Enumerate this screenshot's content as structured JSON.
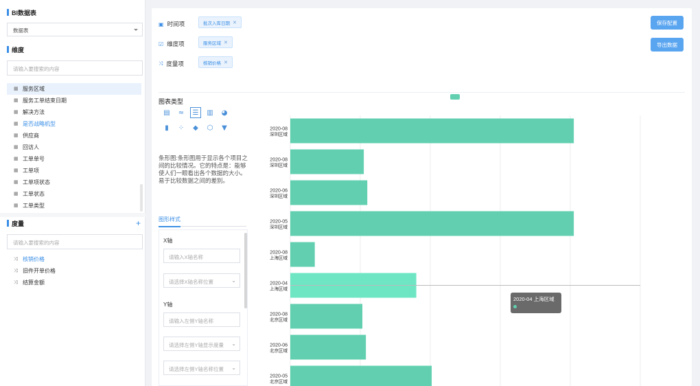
{
  "sidebar": {
    "title": "BI数据表",
    "table_select": "数据表",
    "dimension_title": "维度",
    "dimension_search_placeholder": "请输入要搜索的内容",
    "dimensions": [
      {
        "label": "服务区域",
        "icon": "table-field-icon",
        "highlight": true,
        "blue": false
      },
      {
        "label": "服务工单结束日期",
        "icon": "table-field-icon",
        "highlight": false,
        "blue": false
      },
      {
        "label": "解决方法",
        "icon": "table-field-icon",
        "highlight": false,
        "blue": false
      },
      {
        "label": "是否战略机型",
        "icon": "table-field-icon",
        "highlight": false,
        "blue": true
      },
      {
        "label": "供应商",
        "icon": "table-field-icon",
        "highlight": false,
        "blue": false
      },
      {
        "label": "回访人",
        "icon": "table-field-icon",
        "highlight": false,
        "blue": false
      },
      {
        "label": "工单单号",
        "icon": "table-field-icon",
        "highlight": false,
        "blue": false
      },
      {
        "label": "工单项",
        "icon": "table-field-icon",
        "highlight": false,
        "blue": false
      },
      {
        "label": "工单项状态",
        "icon": "table-field-icon",
        "highlight": false,
        "blue": false
      },
      {
        "label": "工单状态",
        "icon": "table-field-icon",
        "highlight": false,
        "blue": false
      },
      {
        "label": "工单类型",
        "icon": "table-field-icon",
        "highlight": false,
        "blue": false
      }
    ],
    "measure_title": "度量",
    "measure_search_placeholder": "请输入要搜索的内容",
    "measures": [
      {
        "label": "核销价格",
        "icon": "measure-icon",
        "blue": true
      },
      {
        "label": "旧件开单价格",
        "icon": "measure-icon",
        "blue": false
      },
      {
        "label": "结算金额",
        "icon": "measure-icon",
        "blue": false
      }
    ]
  },
  "config": {
    "time_label": "时间项",
    "dimension_label": "维度项",
    "measure_label": "度量项",
    "time_tag": "批次入库日期",
    "dimension_tag": "服务区域",
    "measure_tag": "核销价格",
    "save_button": "保存配置",
    "export_button": "导出数据"
  },
  "chart_panel": {
    "type_title": "图表类型",
    "description": "条形图:条形图用于显示各个项目之间的比较情况。它的特点是：能够使人们一眼看出各个数据的大小。易于比较数据之间的差别。",
    "tab": "图形样式",
    "x_axis_label": "X轴",
    "x_name_placeholder": "请输入X轴名称",
    "x_pos_placeholder": "请选择X轴名称位置",
    "y_axis_label": "Y轴",
    "y_name_placeholder": "请输入左侧Y轴名称",
    "y_show_placeholder": "请选择左侧Y轴显示度量",
    "y_pos_placeholder": "请选择左侧Y轴名称位置"
  },
  "chart_icons": [
    "table-icon",
    "line-chart-icon",
    "bar-chart-icon",
    "column-chart-icon",
    "pie-chart-icon",
    "candlestick-icon",
    "scatter-icon",
    "map-icon",
    "radar-icon",
    "funnel-icon"
  ],
  "chart_data": {
    "type": "bar",
    "orientation": "horizontal",
    "categories": [
      [
        "2020-08",
        "深圳区域"
      ],
      [
        "2020-08",
        "深圳区域"
      ],
      [
        "2020-06",
        "深圳区域"
      ],
      [
        "2020-05",
        "深圳区域"
      ],
      [
        "2020-08",
        "上海区域"
      ],
      [
        "2020-04",
        "上海区域"
      ],
      [
        "2020-08",
        "北京区域"
      ],
      [
        "2020-06",
        "北京区域"
      ],
      [
        "2020-05",
        "北京区域"
      ]
    ],
    "values": [
      4.05,
      1.05,
      1.1,
      4.05,
      0.35,
      1.8,
      1.03,
      1.08,
      2.02
    ],
    "xlim": [
      0,
      5
    ],
    "grid": true,
    "color": "#62d0b0",
    "highlight_color": "#6ee6c4",
    "highlighted_index": 5,
    "tooltip": "2020-04 上海区域"
  }
}
